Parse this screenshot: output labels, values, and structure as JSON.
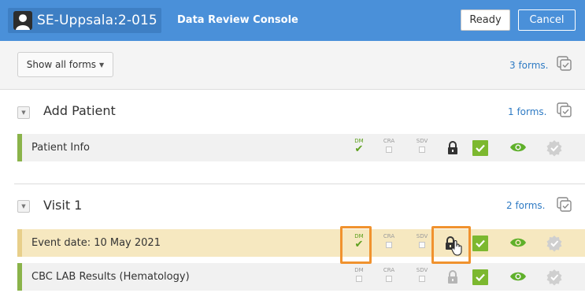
{
  "header": {
    "subject_id": "SE-Uppsala:2-015",
    "title": "Data Review Console",
    "ready_label": "Ready",
    "cancel_label": "Cancel"
  },
  "toolbar": {
    "show_forms_label": "Show all forms",
    "forms_count": "3 forms."
  },
  "sections": [
    {
      "title": "Add Patient",
      "forms_count": "1 forms.",
      "rows": [
        {
          "label": "Patient Info",
          "dm_checked": true,
          "lock_dark": true
        }
      ]
    },
    {
      "title": "Visit 1",
      "forms_count": "2 forms.",
      "rows": [
        {
          "label": "Event date: 10 May 2021",
          "dm_checked": true,
          "lock_dark": true,
          "highlighted": true
        },
        {
          "label": "CBC LAB Results (Hematology)",
          "dm_checked": false,
          "lock_dark": false
        }
      ]
    }
  ],
  "status_labels": {
    "dm": "DM",
    "cra": "CRA",
    "sdv": "SDV"
  },
  "colors": {
    "header_bg": "#4a90d9",
    "accent_green": "#7cb82f",
    "callout_orange": "#f0922e",
    "highlight_row": "#f6e8c0",
    "link_blue": "#2f7bc4"
  }
}
